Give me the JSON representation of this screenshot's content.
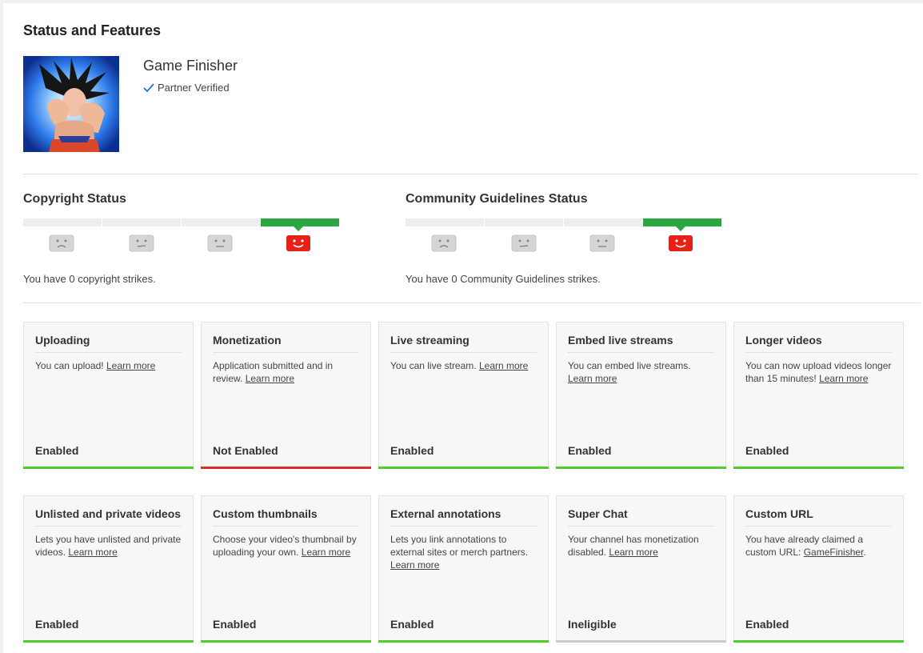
{
  "page": {
    "title": "Status and Features"
  },
  "channel": {
    "name": "Game Finisher",
    "badge": "Partner Verified",
    "avatar_icon": "channel-avatar-anime-character"
  },
  "copyright": {
    "title": "Copyright Status",
    "strikes": 0,
    "text": "You have 0 copyright strikes."
  },
  "community": {
    "title": "Community Guidelines Status",
    "strikes": 0,
    "text": "You have 0 Community Guidelines strikes."
  },
  "colors": {
    "enabled": "#52cc2d",
    "not_enabled": "#d9302c",
    "ineligible": "#cccccc",
    "strike_active": "#2ba640",
    "happy_face": "#e62117",
    "sad_face": "#c8c8c8"
  },
  "features": [
    {
      "title": "Uploading",
      "desc": "You can upload!",
      "link": "Learn more",
      "status": "Enabled",
      "state": "enabled"
    },
    {
      "title": "Monetization",
      "desc": "Application submitted and in review.",
      "link": "Learn more",
      "status": "Not Enabled",
      "state": "not_enabled"
    },
    {
      "title": "Live streaming",
      "desc": "You can live stream.",
      "link": "Learn more",
      "status": "Enabled",
      "state": "enabled"
    },
    {
      "title": "Embed live streams",
      "desc": "You can embed live streams.",
      "link": "Learn more",
      "status": "Enabled",
      "state": "enabled"
    },
    {
      "title": "Longer videos",
      "desc": "You can now upload videos longer than 15 minutes!",
      "link": "Learn more",
      "status": "Enabled",
      "state": "enabled"
    },
    {
      "title": "Unlisted and private videos",
      "desc": "Lets you have unlisted and private videos.",
      "link": "Learn more",
      "status": "Enabled",
      "state": "enabled"
    },
    {
      "title": "Custom thumbnails",
      "desc": "Choose your video's thumbnail by uploading your own.",
      "link": "Learn more",
      "status": "Enabled",
      "state": "enabled"
    },
    {
      "title": "External annotations",
      "desc": "Lets you link annotations to external sites or merch partners.",
      "link": "Learn more",
      "status": "Enabled",
      "state": "enabled"
    },
    {
      "title": "Super Chat",
      "desc": "Your channel has monetization disabled.",
      "link": "Learn more",
      "status": "Ineligible",
      "state": "ineligible"
    },
    {
      "title": "Custom URL",
      "desc": "You have already claimed a custom URL:",
      "link": "GameFinisher",
      "suffix": ".",
      "status": "Enabled",
      "state": "enabled"
    }
  ]
}
